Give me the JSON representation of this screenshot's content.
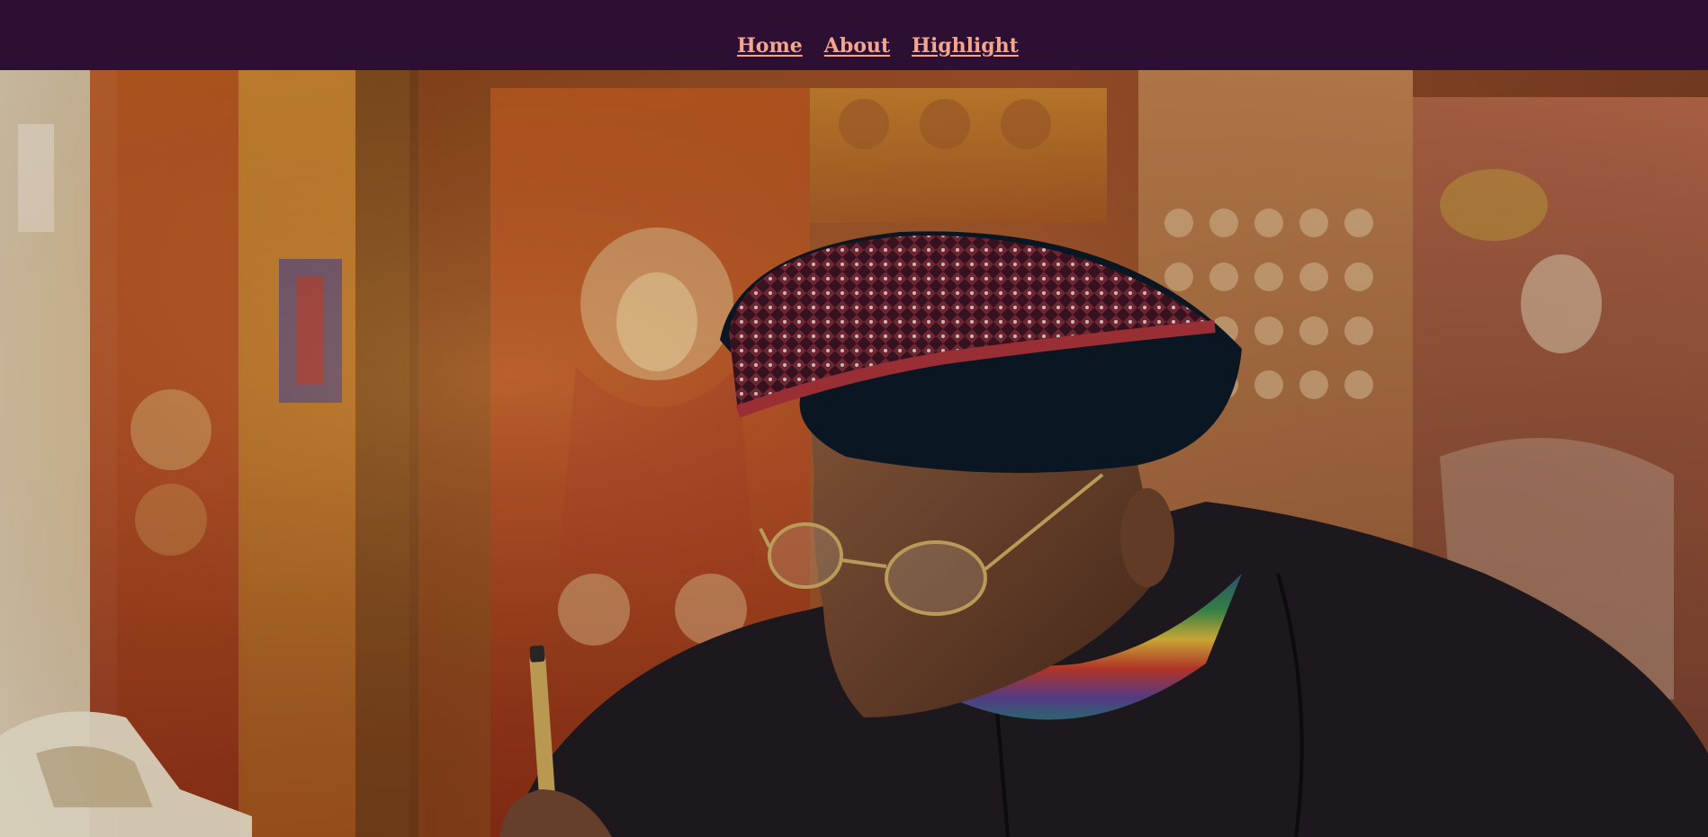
{
  "nav": {
    "items": [
      {
        "label": "Home"
      },
      {
        "label": "About"
      },
      {
        "label": "Highlight"
      }
    ]
  },
  "colors": {
    "topbar_background": "#2d0f33",
    "nav_link": "#f4a58a"
  },
  "hero": {
    "image": "photo-of-elder-in-turban-and-glasses-writing-with-pen-in-front-of-painted-panels"
  }
}
